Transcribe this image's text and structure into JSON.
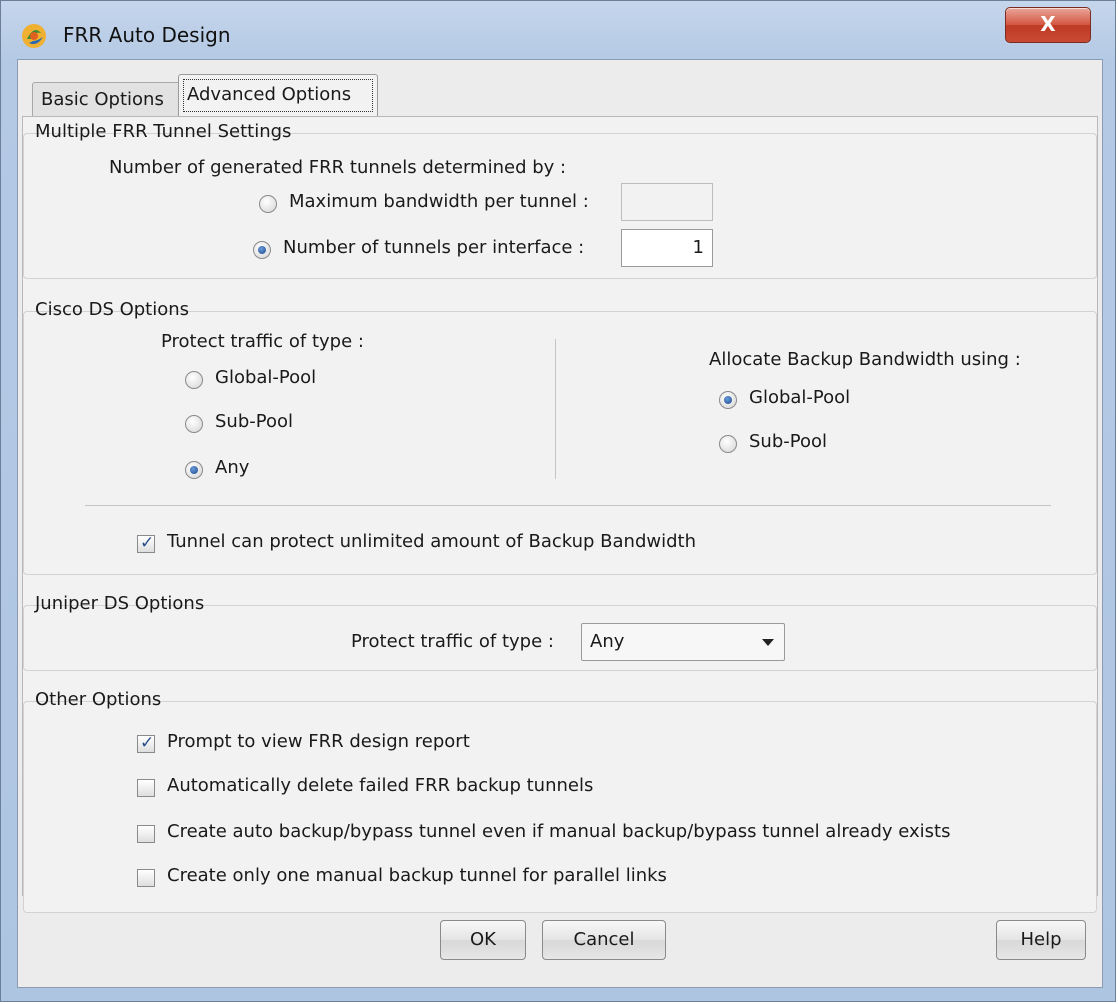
{
  "window": {
    "title": "FRR Auto Design",
    "close_glyph": "X",
    "close_color": "#c94a33",
    "app_icon": "app-logo-icon"
  },
  "tabs": [
    {
      "label": "Basic Options",
      "selected": false
    },
    {
      "label": "Advanced Options",
      "selected": true
    }
  ],
  "multiple_frr": {
    "title": "Multiple FRR Tunnel Settings",
    "determined_by": "Number of generated FRR tunnels determined by :",
    "max_bw_label": "Maximum bandwidth per tunnel :",
    "max_bw_value": "",
    "tunnels_label": "Number of tunnels per interface :",
    "tunnels_value": "1",
    "selected": "tunnels_per_interface"
  },
  "cisco_ds": {
    "title": "Cisco DS Options",
    "protect_label": "Protect traffic of type :",
    "protect_options": [
      "Global-Pool",
      "Sub-Pool",
      "Any"
    ],
    "protect_selected": "Any",
    "allocate_label": "Allocate Backup Bandwidth using :",
    "allocate_options": [
      "Global-Pool",
      "Sub-Pool"
    ],
    "allocate_selected": "Global-Pool",
    "unlimited_label": "Tunnel can protect unlimited amount of Backup Bandwidth",
    "unlimited_checked": true
  },
  "juniper_ds": {
    "title": "Juniper DS Options",
    "protect_label": "Protect traffic of type :",
    "protect_value": "Any"
  },
  "other": {
    "title": "Other Options",
    "items": [
      {
        "label": "Prompt to view FRR design report",
        "checked": true
      },
      {
        "label": "Automatically delete failed FRR backup tunnels",
        "checked": false
      },
      {
        "label": "Create auto backup/bypass tunnel even if manual backup/bypass tunnel already exists",
        "checked": false
      },
      {
        "label": "Create only one manual backup tunnel for parallel links",
        "checked": false
      }
    ]
  },
  "buttons": {
    "ok": "OK",
    "cancel": "Cancel",
    "help": "Help"
  }
}
